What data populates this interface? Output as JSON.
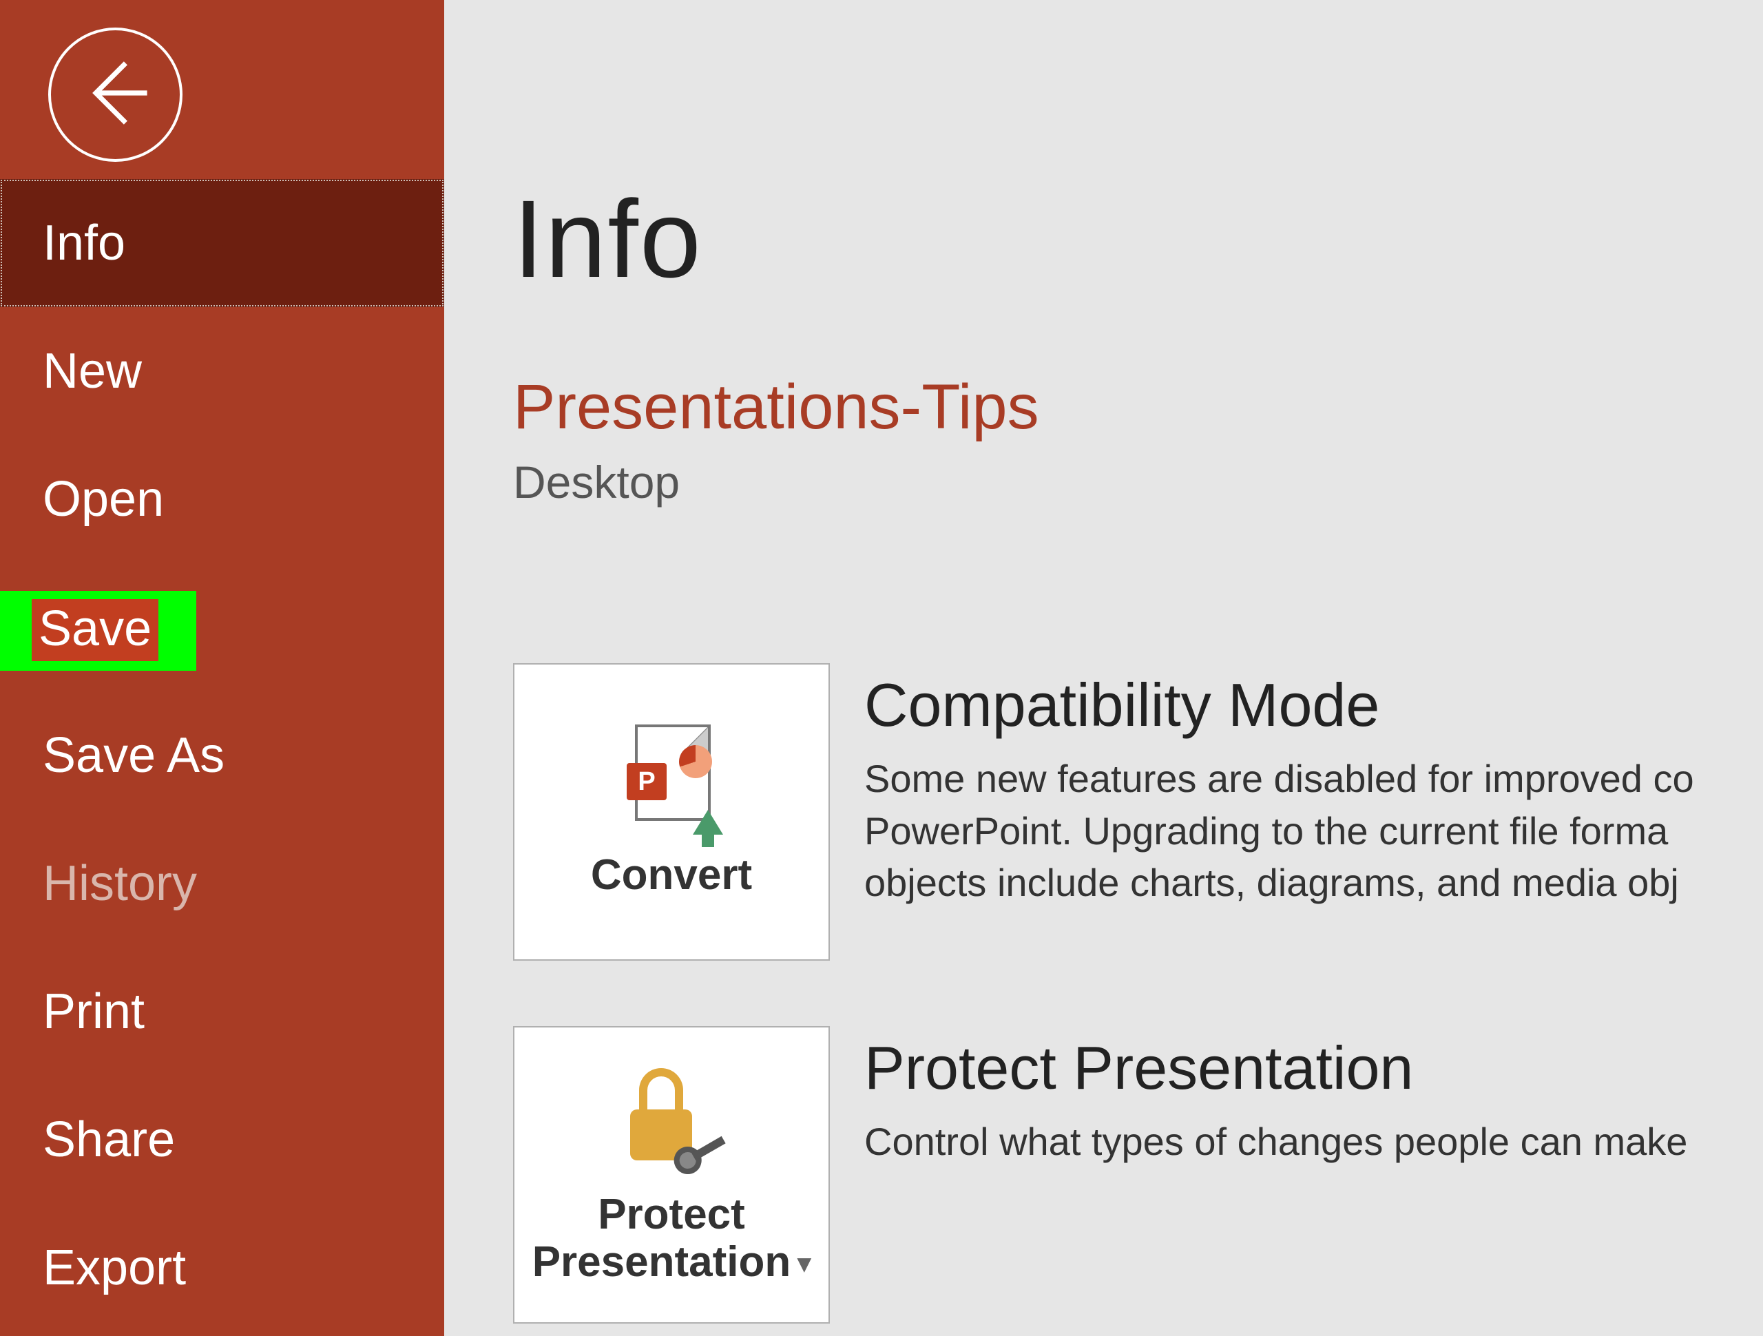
{
  "sidebar": {
    "items": [
      {
        "label": "Info",
        "state": "active"
      },
      {
        "label": "New",
        "state": "normal"
      },
      {
        "label": "Open",
        "state": "normal"
      },
      {
        "label": "Save",
        "state": "highlighted"
      },
      {
        "label": "Save As",
        "state": "normal"
      },
      {
        "label": "History",
        "state": "disabled"
      },
      {
        "label": "Print",
        "state": "normal"
      },
      {
        "label": "Share",
        "state": "normal"
      },
      {
        "label": "Export",
        "state": "normal"
      }
    ]
  },
  "main": {
    "page_title": "Info",
    "file_name": "Presentations-Tips",
    "file_location": "Desktop",
    "sections": [
      {
        "tile_label": "Convert",
        "title": "Compatibility Mode",
        "desc_lines": [
          "Some new features are disabled for improved co",
          "PowerPoint. Upgrading to the current file forma",
          "objects include charts, diagrams, and media obj"
        ]
      },
      {
        "tile_label": "Protect\nPresentation",
        "tile_has_dropdown": true,
        "title": "Protect Presentation",
        "desc_lines": [
          "Control what types of changes people can make"
        ]
      }
    ]
  },
  "colors": {
    "sidebar_bg": "#A83C25",
    "sidebar_active_bg": "#6D1F10",
    "highlight": "#00ff00",
    "accent": "#C23E20",
    "main_bg": "#E6E6E6"
  }
}
